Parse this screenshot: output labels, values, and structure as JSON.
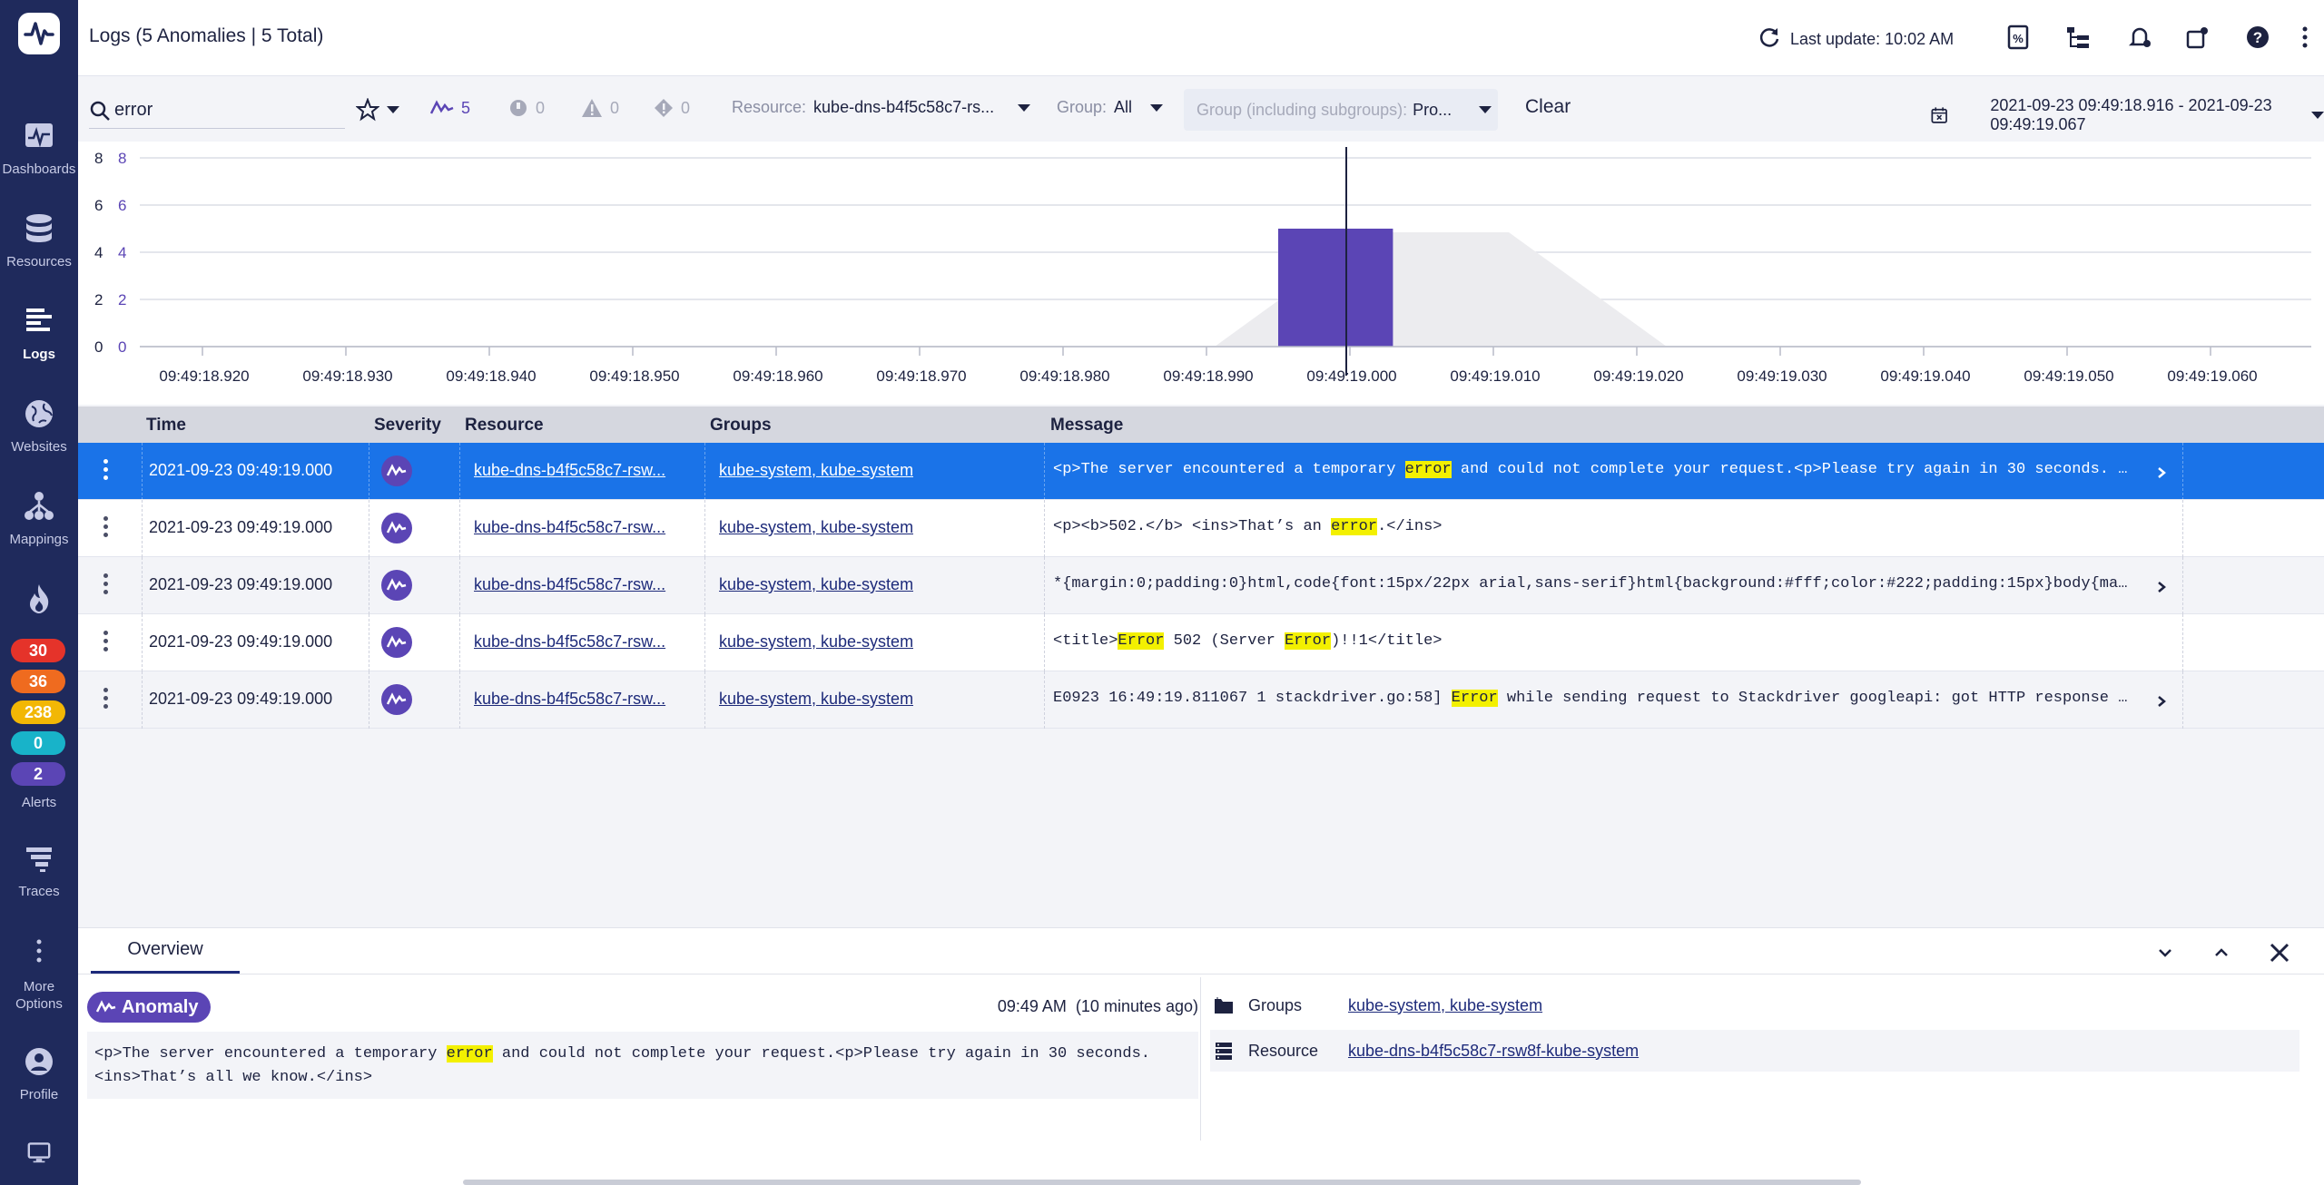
{
  "sidebar": {
    "items": [
      {
        "label": "Dashboards",
        "icon": "dashboard-icon"
      },
      {
        "label": "Resources",
        "icon": "database-icon"
      },
      {
        "label": "Logs",
        "icon": "logs-icon"
      },
      {
        "label": "Websites",
        "icon": "globe-icon"
      },
      {
        "label": "Mappings",
        "icon": "topology-icon"
      }
    ],
    "alert_counts": [
      {
        "value": "30",
        "color": "#e5332a"
      },
      {
        "value": "36",
        "color": "#ef6b1f"
      },
      {
        "value": "238",
        "color": "#f2b705"
      },
      {
        "value": "0",
        "color": "#18b3c9"
      },
      {
        "value": "2",
        "color": "#5b45b5"
      }
    ],
    "alerts_label": "Alerts",
    "traces_label": "Traces",
    "more_label": "More Options",
    "profile_label": "Profile"
  },
  "header": {
    "title": "Logs (5 Anomalies | 5 Total)",
    "last_update": "Last update: 10:02 AM"
  },
  "filters": {
    "search_value": "error",
    "anomalies_count": "5",
    "info_count": "0",
    "warn_count": "0",
    "error_count": "0",
    "resource_label": "Resource:",
    "resource_value": "kube-dns-b4f5c58c7-rs...",
    "group_label": "Group:",
    "group_value": "All",
    "group_incl_label": "Group (including subgroups):",
    "group_incl_value": "Pro...",
    "clear_label": "Clear",
    "date_range": "2021-09-23 09:49:18.916 - 2021-09-23 09:49:19.067"
  },
  "chart_data": {
    "type": "bar",
    "y_ticks": [
      "0",
      "2",
      "4",
      "6",
      "8"
    ],
    "ylim": [
      0,
      8
    ],
    "x_ticks": [
      "09:49:18.920",
      "09:49:18.930",
      "09:49:18.940",
      "09:49:18.950",
      "09:49:18.960",
      "09:49:18.970",
      "09:49:18.980",
      "09:49:18.990",
      "09:49:19.000",
      "09:49:19.010",
      "09:49:19.020",
      "09:49:19.030",
      "09:49:19.040",
      "09:49:19.050",
      "09:49:19.060"
    ],
    "bars": [
      {
        "start": "09:49:18.995",
        "end": "09:49:19.003",
        "value": 5
      }
    ],
    "cursor_x": "09:49:19.000",
    "bar_color": "#5b45b5"
  },
  "table": {
    "columns": {
      "time": "Time",
      "severity": "Severity",
      "resource": "Resource",
      "groups": "Groups",
      "message": "Message"
    },
    "rows": [
      {
        "time": "2021-09-23 09:49:19.000",
        "resource": "kube-dns-b4f5c58c7-rsw...",
        "groups": "kube-system, kube-system",
        "msg_parts": [
          "<p>The server encountered a temporary ",
          "error",
          " and could not complete your request.<p>Please try again in 30 seconds. …"
        ],
        "expandable": true
      },
      {
        "time": "2021-09-23 09:49:19.000",
        "resource": "kube-dns-b4f5c58c7-rsw...",
        "groups": "kube-system, kube-system",
        "msg_parts": [
          "<p><b>502.</b> <ins>That’s an ",
          "error",
          ".</ins>"
        ],
        "expandable": false
      },
      {
        "time": "2021-09-23 09:49:19.000",
        "resource": "kube-dns-b4f5c58c7-rsw...",
        "groups": "kube-system, kube-system",
        "msg_parts": [
          "*{margin:0;padding:0}html,code{font:15px/22px arial,sans-serif}html{background:#fff;color:#222;padding:15px}body{ma…",
          "",
          ""
        ],
        "expandable": true
      },
      {
        "time": "2021-09-23 09:49:19.000",
        "resource": "kube-dns-b4f5c58c7-rsw...",
        "groups": "kube-system, kube-system",
        "msg_parts": [
          "<title>",
          "Error",
          " 502 (Server ",
          "Error",
          ")!!1</title>"
        ],
        "expandable": false
      },
      {
        "time": "2021-09-23 09:49:19.000",
        "resource": "kube-dns-b4f5c58c7-rsw...",
        "groups": "kube-system, kube-system",
        "msg_parts": [
          "E0923 16:49:19.811067 1 stackdriver.go:58] ",
          "Error",
          " while sending request to Stackdriver googleapi: got HTTP response …"
        ],
        "expandable": true
      }
    ]
  },
  "detail": {
    "tab_label": "Overview",
    "badge_label": "Anomaly",
    "time": "09:49 AM  (10 minutes ago)",
    "msg_line1_pre": "<p>The server encountered a temporary ",
    "msg_line1_hl": "error",
    "msg_line1_post": " and could not complete your request.<p>Please try again in 30 seconds.",
    "msg_line2": "<ins>That’s all we know.</ins>",
    "groups_label": "Groups",
    "groups_value": "kube-system, kube-system",
    "resource_label": "Resource",
    "resource_value": "kube-dns-b4f5c58c7-rsw8f-kube-system"
  }
}
